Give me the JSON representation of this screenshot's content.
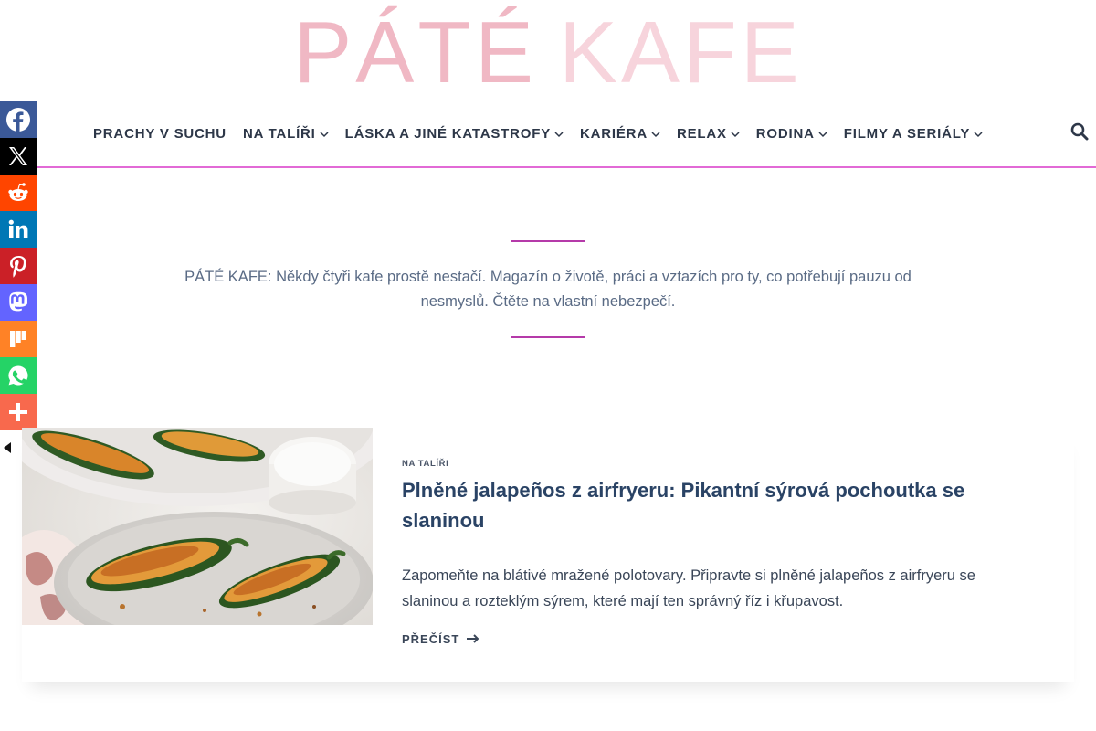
{
  "site": {
    "logo_word1": "PÁTÉ",
    "logo_word2": "KAFE",
    "logo_colors": {
      "word1": "#f0b8c4",
      "word2": "#f7d4dc"
    }
  },
  "nav": {
    "items": [
      {
        "label": "PRACHY V SUCHU",
        "has_dropdown": false
      },
      {
        "label": "NA TALÍŘI",
        "has_dropdown": true
      },
      {
        "label": "LÁSKA A JINÉ KATASTROFY",
        "has_dropdown": true
      },
      {
        "label": "KARIÉRA",
        "has_dropdown": true
      },
      {
        "label": "RELAX",
        "has_dropdown": true
      },
      {
        "label": "RODINA",
        "has_dropdown": true
      },
      {
        "label": "FILMY A SERIÁLY",
        "has_dropdown": true
      }
    ],
    "search_icon": "search-icon",
    "underline_color": "#e26ad6"
  },
  "social": [
    {
      "name": "Facebook",
      "icon": "facebook-icon",
      "color": "#3b5998"
    },
    {
      "name": "X",
      "icon": "x-icon",
      "color": "#000000"
    },
    {
      "name": "Reddit",
      "icon": "reddit-icon",
      "color": "#ff4500"
    },
    {
      "name": "Linkedin",
      "icon": "linkedin-icon",
      "color": "#0077b5"
    },
    {
      "name": "Pinterest",
      "icon": "pinterest-icon",
      "color": "#cb2027"
    },
    {
      "name": "Mastodon",
      "icon": "mastodon-icon",
      "color": "#6364ff"
    },
    {
      "name": "Mix",
      "icon": "mix-icon",
      "color": "#ff8226"
    },
    {
      "name": "Whatsapp",
      "icon": "whatsapp-icon",
      "color": "#25d366"
    },
    {
      "name": "More",
      "icon": "plus-icon",
      "color": "#f8694d"
    }
  ],
  "intro": {
    "tagline": "PÁTÉ KAFE: Někdy čtyři kafe prostě nestačí. Magazín o životě, práci a vztazích pro ty, co potřebují pauzu od nesmyslů. Čtěte na vlastní nebezpečí.",
    "rule_color": "#b53aa9"
  },
  "article": {
    "category": "NA TALÍŘI",
    "title": "Plněné jalapeños z airfryeru: Pikantní sýrová pochoutka se slaninou",
    "excerpt": "Zapomeňte na blátivé mražené polotovary. Připravte si plněné jalapeños z airfryeru se slaninou a rozteklým sýrem, které mají ten správný říz i křupavost.",
    "read_more": "PŘEČÍST"
  }
}
